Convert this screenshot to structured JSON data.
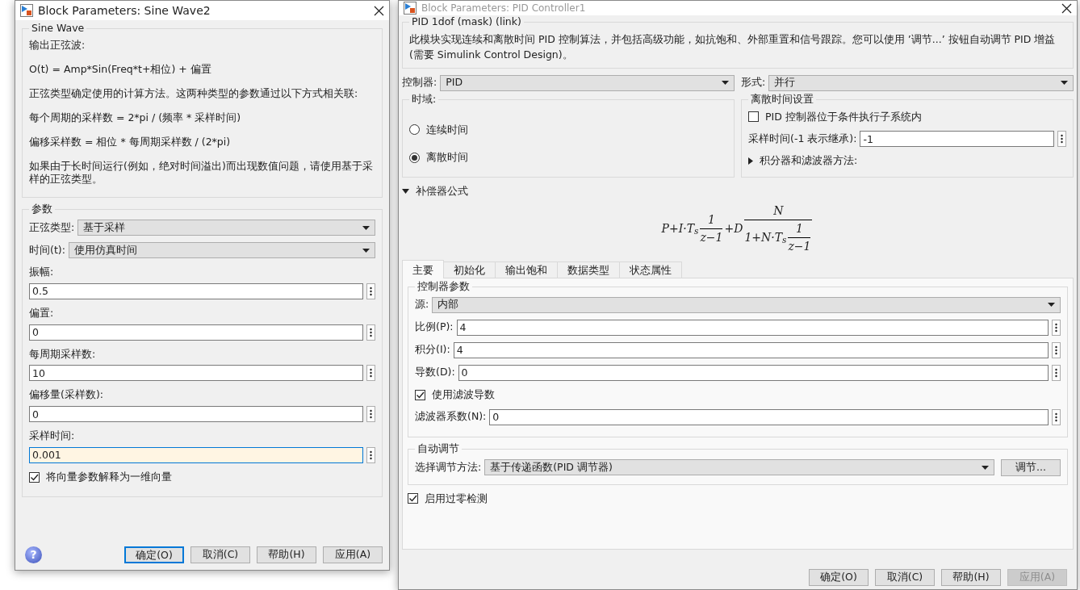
{
  "sine_dialog": {
    "title": "Block Parameters: Sine Wave2",
    "active": true,
    "description_group": {
      "title": "Sine Wave",
      "lines": [
        "输出正弦波:",
        "O(t) = Amp*Sin(Freq*t+相位) + 偏置",
        "正弦类型确定使用的计算方法。这两种类型的参数通过以下方式相关联:",
        "每个周期的采样数 = 2*pi / (频率 * 采样时间)",
        "偏移采样数 = 相位 * 每周期采样数 / (2*pi)",
        "如果由于长时间运行(例如，绝对时间溢出)而出现数值问题，请使用基于采样的正弦类型。"
      ]
    },
    "parameters_group": {
      "title": "参数",
      "items": [
        {
          "kind": "select",
          "label": "正弦类型:",
          "value": "基于采样"
        },
        {
          "kind": "select",
          "label": "时间(t):",
          "value": "使用仿真时间"
        },
        {
          "kind": "field",
          "label": "振幅:",
          "value": "0.5",
          "focused": false
        },
        {
          "kind": "field",
          "label": "偏置:",
          "value": "0",
          "focused": false
        },
        {
          "kind": "field",
          "label": "每周期采样数:",
          "value": "10",
          "focused": false
        },
        {
          "kind": "field",
          "label": "偏移量(采样数):",
          "value": "0",
          "focused": false
        },
        {
          "kind": "field",
          "label": "采样时间:",
          "value": "0.001",
          "focused": true
        },
        {
          "kind": "checkbox",
          "label": "将向量参数解释为一维向量",
          "checked": true
        }
      ]
    },
    "help": "?",
    "buttons": [
      {
        "label": "确定(O)",
        "focused": true,
        "disabled": false
      },
      {
        "label": "取消(C)",
        "focused": false,
        "disabled": false
      },
      {
        "label": "帮助(H)",
        "focused": false,
        "disabled": false
      },
      {
        "label": "应用(A)",
        "focused": false,
        "disabled": false
      }
    ]
  },
  "pid_dialog": {
    "title": "Block Parameters: PID Controller1",
    "active": false,
    "description_group": {
      "title": "PID 1dof (mask) (link)",
      "text": "此模块实现连续和离散时间 PID 控制算法，并包括高级功能，如抗饱和、外部重置和信号跟踪。您可以使用 ’调节...’ 按钮自动调节 PID 增益(需要 Simulink Control Design)。"
    },
    "controller": {
      "kind": "select",
      "label": "控制器:",
      "value": "PID"
    },
    "form": {
      "kind": "select",
      "label": "形式:",
      "value": "并行"
    },
    "time_domain": {
      "title": "时域:",
      "options": [
        {
          "label": "连续时间",
          "selected": false
        },
        {
          "label": "离散时间",
          "selected": true
        }
      ]
    },
    "discrete_settings": {
      "title": "离散时间设置",
      "items": [
        {
          "kind": "checkbox",
          "label": "PID 控制器位于条件执行子系统内",
          "checked": false
        },
        {
          "kind": "field",
          "label": "采样时间(-1 表示继承):",
          "value": "-1",
          "focused": false
        },
        {
          "kind": "expander",
          "label": "积分器和滤波器方法:",
          "expanded": false
        }
      ]
    },
    "compensator": {
      "label": "补偿器公式",
      "expanded": true,
      "formula": {
        "lead": "P+I·T$_{s}$",
        "f1": {
          "num": "1",
          "den": "z−1"
        },
        "mid": "+D",
        "f2": {
          "num": "N",
          "den_lead": "1+N·T$_{s}$",
          "den_frac": {
            "num": "1",
            "den": "z−1"
          }
        }
      }
    },
    "tabs": [
      {
        "label": "主要",
        "selected": true
      },
      {
        "label": "初始化",
        "selected": false
      },
      {
        "label": "输出饱和",
        "selected": false
      },
      {
        "label": "数据类型",
        "selected": false
      },
      {
        "label": "状态属性",
        "selected": false
      }
    ],
    "controller_params": {
      "title": "控制器参数",
      "items": [
        {
          "kind": "select",
          "label": "源:",
          "value": "内部"
        },
        {
          "kind": "field",
          "label": "比例(P):",
          "value": "4",
          "focused": false
        },
        {
          "kind": "field",
          "label": "积分(I):",
          "value": "4",
          "focused": false
        },
        {
          "kind": "field",
          "label": "导数(D):",
          "value": "0",
          "focused": false
        },
        {
          "kind": "checkbox",
          "label": "使用滤波导数",
          "checked": true
        },
        {
          "kind": "field",
          "label": "滤波器系数(N):",
          "value": "0",
          "focused": false
        }
      ]
    },
    "autotune": {
      "title": "自动调节",
      "label": "选择调节方法:",
      "value": "基于传递函数(PID 调节器)",
      "button": "调节..."
    },
    "zero_crossing": {
      "label": "启用过零检测",
      "checked": true
    },
    "buttons": [
      {
        "label": "确定(O)",
        "focused": false,
        "disabled": false
      },
      {
        "label": "取消(C)",
        "focused": false,
        "disabled": false
      },
      {
        "label": "帮助(H)",
        "focused": false,
        "disabled": false
      },
      {
        "label": "应用(A)",
        "focused": false,
        "disabled": true
      }
    ]
  }
}
